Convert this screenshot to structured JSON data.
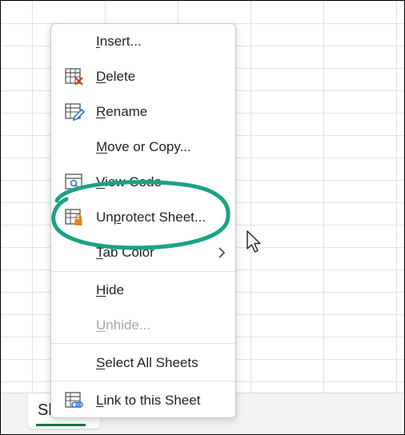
{
  "sheet_tab": {
    "label": "Sh"
  },
  "context_menu": {
    "items": [
      {
        "id": "insert",
        "pre": "",
        "key": "I",
        "post": "nsert...",
        "icon": "none",
        "disabled": false
      },
      {
        "id": "delete",
        "pre": "",
        "key": "D",
        "post": "elete",
        "icon": "delete-sheet-icon",
        "disabled": false
      },
      {
        "id": "rename",
        "pre": "",
        "key": "R",
        "post": "ename",
        "icon": "rename-sheet-icon",
        "disabled": false
      },
      {
        "id": "move-copy",
        "pre": "",
        "key": "M",
        "post": "ove or Copy...",
        "icon": "none",
        "disabled": false
      },
      {
        "id": "view-code",
        "pre": "",
        "key": "V",
        "post": "iew Code",
        "icon": "view-code-icon",
        "disabled": false
      },
      {
        "id": "unprotect",
        "pre": "Un",
        "key": "p",
        "post": "rotect Sheet...",
        "icon": "unprotect-sheet-icon",
        "disabled": false
      },
      {
        "id": "tab-color",
        "pre": "",
        "key": "T",
        "post": "ab Color",
        "icon": "none",
        "disabled": false,
        "submenu": "chevron-right-icon"
      },
      {
        "id": "hide",
        "pre": "",
        "key": "H",
        "post": "ide",
        "icon": "none",
        "disabled": false
      },
      {
        "id": "unhide",
        "pre": "",
        "key": "U",
        "post": "nhide...",
        "icon": "none",
        "disabled": true
      },
      {
        "id": "select-all",
        "pre": "",
        "key": "S",
        "post": "elect All Sheets",
        "icon": "none",
        "disabled": false
      },
      {
        "id": "link-sheet",
        "pre": "",
        "key": "L",
        "post": "ink to this Sheet",
        "icon": "link-sheet-icon",
        "disabled": false
      }
    ]
  },
  "colors": {
    "annotation_circle": "#1aa384",
    "icon_accent_red": "#d83b01",
    "icon_accent_blue": "#2b78d4",
    "icon_accent_orange": "#e3861b",
    "tab_underline": "#107c41"
  }
}
